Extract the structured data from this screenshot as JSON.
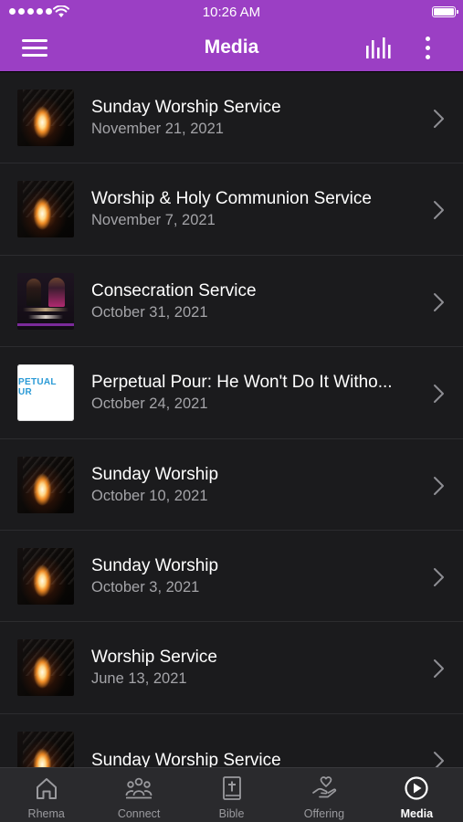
{
  "status_bar": {
    "time": "10:26 AM"
  },
  "header": {
    "title": "Media",
    "menu_icon": "hamburger-menu-icon",
    "equalizer_icon": "equalizer-bars-icon",
    "more_icon": "vertical-dots-icon",
    "background_color": "#9b3fc4"
  },
  "media_list": {
    "items": [
      {
        "title": "Sunday Worship Service",
        "date": "November 21, 2021",
        "thumbnail": "fire"
      },
      {
        "title": "Worship & Holy Communion Service",
        "date": "November 7, 2021",
        "thumbnail": "fire"
      },
      {
        "title": "Consecration Service",
        "date": "October 31, 2021",
        "thumbnail": "poster"
      },
      {
        "title": "Perpetual Pour: He Won't Do It Witho...",
        "date": "October 24, 2021",
        "thumbnail": "perpetual",
        "thumbnail_text": "PETUAL\nUR"
      },
      {
        "title": "Sunday Worship",
        "date": "October 10, 2021",
        "thumbnail": "fire"
      },
      {
        "title": "Sunday Worship",
        "date": "October 3, 2021",
        "thumbnail": "fire"
      },
      {
        "title": "Worship Service",
        "date": "June 13, 2021",
        "thumbnail": "fire"
      },
      {
        "title": "Sunday Worship Service",
        "date": "",
        "thumbnail": "fire"
      }
    ]
  },
  "tab_bar": {
    "tabs": [
      {
        "label": "Rhema",
        "icon": "home-icon",
        "active": false
      },
      {
        "label": "Connect",
        "icon": "people-group-icon",
        "active": false
      },
      {
        "label": "Bible",
        "icon": "bible-cross-icon",
        "active": false
      },
      {
        "label": "Offering",
        "icon": "giving-hand-icon",
        "active": false
      },
      {
        "label": "Media",
        "icon": "play-circle-icon",
        "active": true
      }
    ]
  }
}
